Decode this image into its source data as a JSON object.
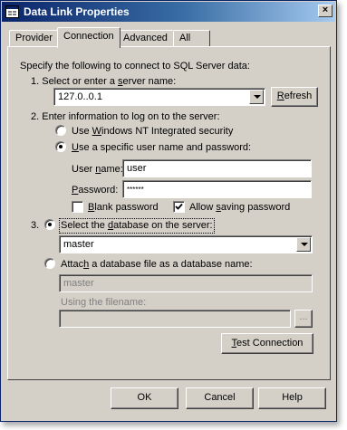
{
  "window": {
    "title": "Data Link Properties",
    "close_glyph": "×"
  },
  "tabs": [
    {
      "label": "Provider",
      "mnemonic_index": -1
    },
    {
      "label": "Connection",
      "active": true
    },
    {
      "label": "Advanced"
    },
    {
      "label": "All"
    }
  ],
  "connection": {
    "intro": "Specify the following to connect to SQL Server data:",
    "step1": {
      "pre": "1. Select or enter a ",
      "u": "s",
      "post": "erver name:"
    },
    "server_value": "127.0..0.1",
    "refresh": {
      "u": "R",
      "post": "efresh"
    },
    "step2": "2. Enter information to log on to the server:",
    "auth_windows": {
      "pre": "Use ",
      "u": "W",
      "post": "indows NT Integrated security",
      "checked": false
    },
    "auth_specific": {
      "pre": "",
      "u": "U",
      "post": "se a specific user name and password:",
      "checked": true
    },
    "username_label": {
      "pre": "User ",
      "u": "n",
      "post": "ame:"
    },
    "username_value": "user",
    "password_label": {
      "pre": "",
      "u": "P",
      "post": "assword:"
    },
    "password_value": "******",
    "blank_password": {
      "pre": "",
      "u": "B",
      "post": "lank password",
      "checked": false
    },
    "allow_saving": {
      "pre": "Allow ",
      "u": "s",
      "post": "aving password",
      "checked": true
    },
    "step3_num": "3.",
    "select_db": {
      "pre": "Select the ",
      "u": "d",
      "post": "atabase on the server:",
      "checked": true
    },
    "database_value": "master",
    "attach_db": {
      "pre": "Attac",
      "u": "h",
      "post": " a database file as a database name:",
      "checked": false
    },
    "attach_name_value": "master",
    "using_filename_label": "Using the filename:",
    "browse_label": "...",
    "test_connection": {
      "pre": "",
      "u": "T",
      "post": "est Connection"
    }
  },
  "footer": {
    "ok": "OK",
    "cancel": "Cancel",
    "help": "Help"
  }
}
